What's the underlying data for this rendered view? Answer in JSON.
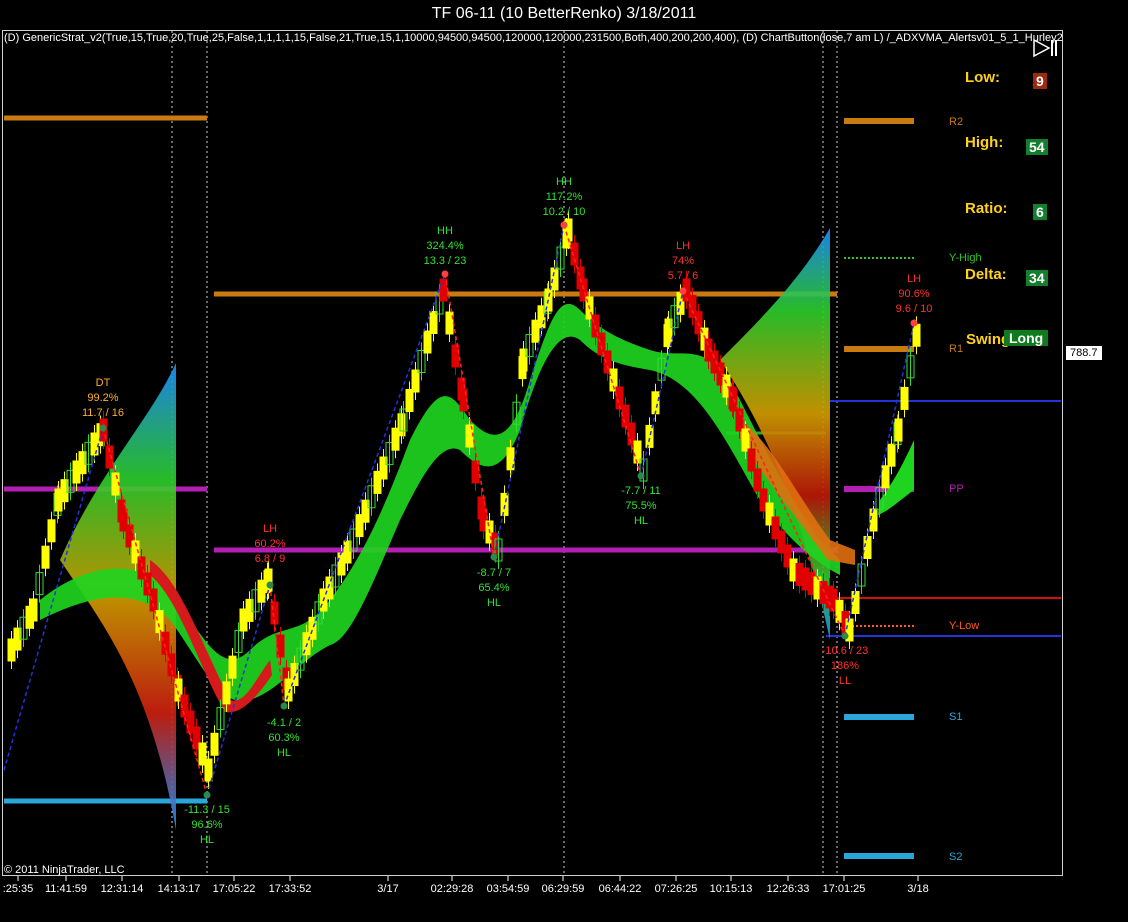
{
  "window": {
    "title": "TF 06-11 (10 BetterRenko)  3/18/2011"
  },
  "indicator_label": "(D) GenericStrat_v2(True,15,True,20,True,25,False,1,1,1,1,15,False,21,True,15,1,10000,94500,94500,120000,120000,231500,Both,400,200,200,400), (D) ChartButton(lose,7 am L) /_ADXVMA_Alertsv01_5_1_Hurley2",
  "copyright": "© 2011 NinjaTrader, LLC",
  "last_price": "788.7",
  "stats": {
    "low_label": "Low:",
    "low_value": "9",
    "high_label": "High:",
    "high_value": "54",
    "ratio_label": "Ratio:",
    "ratio_value": "6",
    "delta_label": "Delta:",
    "delta_value": "34",
    "swing_label": "Swing",
    "swing_value": "Long"
  },
  "colors": {
    "up": "#ffff00",
    "down": "#e00000",
    "hollow": "#33dd33",
    "ribbon": "#1fd41f",
    "zz_up": "#2233dd",
    "zz_down": "#ff2020"
  },
  "chart_data": {
    "type": "candlestick-renko",
    "x_ticks": [
      ":25:35",
      "11:41:59",
      "12:31:14",
      "14:13:17",
      "17:05:22",
      "17:33:52",
      "3/17",
      "02:29:28",
      "03:54:59",
      "06:29:59",
      "06:44:22",
      "07:26:25",
      "10:15:13",
      "12:26:33",
      "17:01:25",
      "3/18"
    ],
    "levels": [
      {
        "name": "R2",
        "color": "#c97b12"
      },
      {
        "name": "Y-High",
        "color": "#2fc42f"
      },
      {
        "name": "R1",
        "color": "#c97b12"
      },
      {
        "name": "PP",
        "color": "#b31fb3"
      },
      {
        "name": "Y-Low",
        "color": "#ff5a1a"
      },
      {
        "name": "S1",
        "color": "#2aa6d8"
      },
      {
        "name": "S2",
        "color": "#2aa6d8"
      }
    ],
    "annotations": [
      {
        "lines": [
          "DT",
          "99.2%",
          "11.7 / 16"
        ],
        "color": "#ffb030"
      },
      {
        "lines": [
          "-11.3 / 15",
          "96.6%",
          "HL"
        ],
        "color": "#33e033"
      },
      {
        "lines": [
          "LH",
          "60.2%",
          "6.8 / 9"
        ],
        "color": "#ff3030"
      },
      {
        "lines": [
          "-4.1 / 2",
          "60.3%",
          "HL"
        ],
        "color": "#33e033"
      },
      {
        "lines": [
          "HH",
          "324.4%",
          "13.3 / 23"
        ],
        "color": "#33e033"
      },
      {
        "lines": [
          "-8.7 / 7",
          "65.4%",
          "HL"
        ],
        "color": "#33e033"
      },
      {
        "lines": [
          "HH",
          "117.2%",
          "10.2 / 10"
        ],
        "color": "#33e033"
      },
      {
        "lines": [
          "-7.7 / 11",
          "75.5%",
          "HL"
        ],
        "color": "#33e033"
      },
      {
        "lines": [
          "LH",
          "74%",
          "5.7 / 6"
        ],
        "color": "#ff3030"
      },
      {
        "lines": [
          "-10.6 / 23",
          "186%",
          "LL"
        ],
        "color": "#ff3030"
      },
      {
        "lines": [
          "LH",
          "90.6%",
          "9.6 / 10"
        ],
        "color": "#ff3030"
      }
    ]
  }
}
